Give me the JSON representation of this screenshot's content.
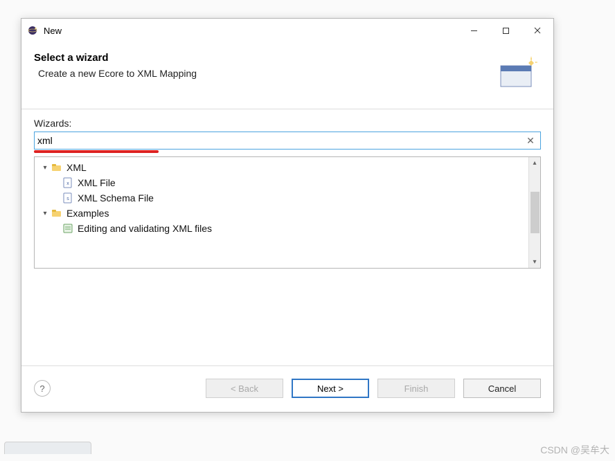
{
  "window": {
    "title": "New"
  },
  "header": {
    "title": "Select a wizard",
    "subtitle": "Create a new Ecore to XML Mapping"
  },
  "wizards_label": "Wizards:",
  "filter": {
    "value": "xml"
  },
  "tree": {
    "nodes": [
      {
        "label": "XML",
        "kind": "folder",
        "expanded": true,
        "children": [
          {
            "label": "XML File",
            "kind": "xml-file"
          },
          {
            "label": "XML Schema File",
            "kind": "xsd-file"
          }
        ]
      },
      {
        "label": "Examples",
        "kind": "folder",
        "expanded": true,
        "children": [
          {
            "label": "Editing and validating XML files",
            "kind": "example"
          }
        ]
      }
    ]
  },
  "buttons": {
    "back": "< Back",
    "next": "Next >",
    "finish": "Finish",
    "cancel": "Cancel"
  },
  "watermark": "CSDN @吴牟大"
}
